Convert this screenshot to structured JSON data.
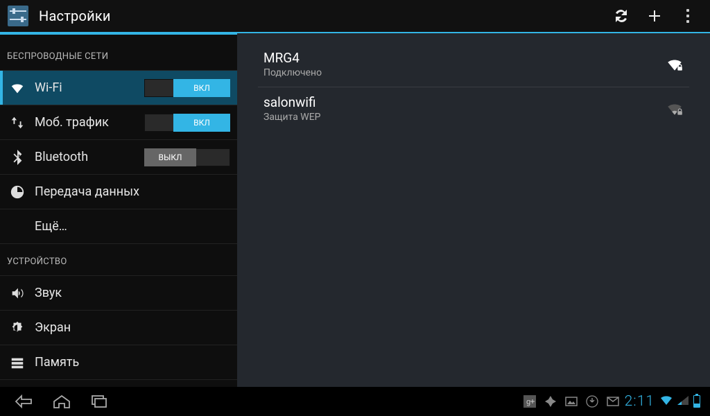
{
  "actionbar": {
    "title": "Настройки"
  },
  "sidebar": {
    "header_wireless": "БЕСПРОВОДНЫЕ СЕТИ",
    "header_device": "УСТРОЙСТВО",
    "wifi_label": "Wi-Fi",
    "mobile_label": "Моб. трафик",
    "bluetooth_label": "Bluetooth",
    "data_label": "Передача данных",
    "more_label": "Ещё…",
    "sound_label": "Звук",
    "display_label": "Экран",
    "storage_label": "Память",
    "toggle_on": "ВКЛ",
    "toggle_off": "ВЫКЛ"
  },
  "networks": {
    "n0": {
      "ssid": "MRG4",
      "status": "Подключено"
    },
    "n1": {
      "ssid": "salonwifi",
      "status": "Защита WEP"
    }
  },
  "statusbar": {
    "clock": "2:11"
  }
}
